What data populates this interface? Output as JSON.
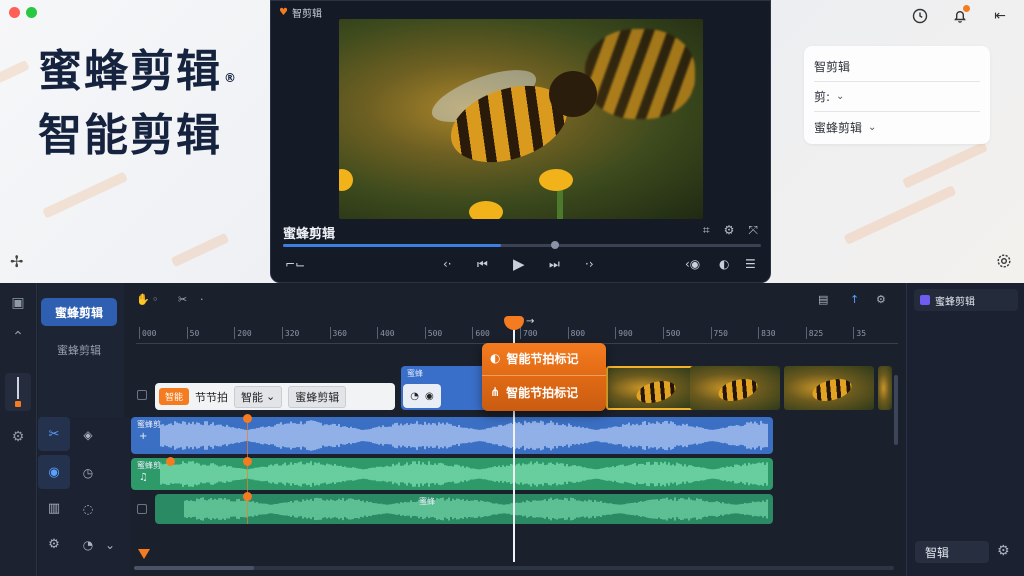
{
  "brand": {
    "line1": "蜜蜂剪辑",
    "line2": "智能剪辑",
    "reg": "®"
  },
  "top_right_icons": [
    "clock-icon",
    "bell-icon",
    "pin-icon"
  ],
  "right_card": {
    "title": "智剪辑",
    "row2": "剪:",
    "row3": "蜜蜂剪辑"
  },
  "preview": {
    "window_title": "智剪辑",
    "clip_name": "蜜蜂剪辑",
    "progress": 0.57,
    "tool_icons": [
      "crop-icon",
      "settings-icon",
      "fullscreen-icon"
    ],
    "transport_icons": [
      "fit-icon",
      "rewind-icon",
      "previous-icon",
      "play-icon",
      "next-icon",
      "forward-icon",
      "volume-icon",
      "menu-icon"
    ]
  },
  "nav": {
    "active_tab": "蜜蜂剪辑",
    "other_tab": "蜜蜂剪辑"
  },
  "ruler_ticks": [
    "000",
    "50",
    "200",
    "320",
    "360",
    "400",
    "500",
    "600",
    "700",
    "800",
    "900",
    "500",
    "750",
    "830",
    "825",
    "35"
  ],
  "chips": {
    "orange_badge": "智能",
    "item1": "节节拍",
    "item2": "智能",
    "item3": "蜜蜂剪辑"
  },
  "blue_clip": {
    "label": "蜜蜂",
    "pill_icons": [
      "lock-icon",
      "eye-icon"
    ]
  },
  "beat_popup": {
    "row1": "智能节拍标记",
    "row2": "智能节拍标记"
  },
  "audio_tracks": [
    {
      "label": "蜜蜂剪",
      "sub": "+",
      "color": "#3b6fc4"
    },
    {
      "label": "蜜蜂剪",
      "sub": "♫",
      "color": "#2e9a6a"
    },
    {
      "label": "",
      "sub": "",
      "color": "#2a8a63",
      "mid_label": "蜜蜂"
    }
  ],
  "right_panel": {
    "title": "蜜蜂剪辑",
    "button": "智辑"
  },
  "colors": {
    "accent_orange": "#f47b20",
    "accent_blue": "#2f5fb0",
    "editor_bg": "#1a202c",
    "audio_blue": "#3b6fc4",
    "audio_green": "#2e9a6a"
  }
}
